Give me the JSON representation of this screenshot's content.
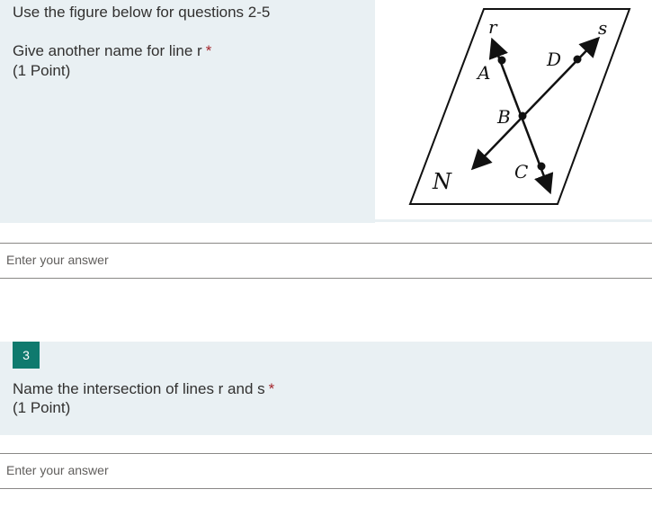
{
  "question2": {
    "intro": "Use the figure below for questions 2-5",
    "title": "Give another name for line r",
    "required_marker": "*",
    "points": "(1 Point)",
    "answer_placeholder": "Enter your answer"
  },
  "figure": {
    "labels": {
      "line_r": "r",
      "line_s": "s",
      "point_a": "A",
      "point_b": "B",
      "point_c": "C",
      "point_d": "D",
      "plane": "N"
    }
  },
  "question3": {
    "number": "3",
    "title": "Name the intersection of lines r and s",
    "required_marker": "*",
    "points": "(1 Point)",
    "answer_placeholder": "Enter your answer"
  },
  "colors": {
    "question_background": "#e9f0f3",
    "number_badge": "#0f7a6e",
    "required_marker": "#a4262c"
  }
}
